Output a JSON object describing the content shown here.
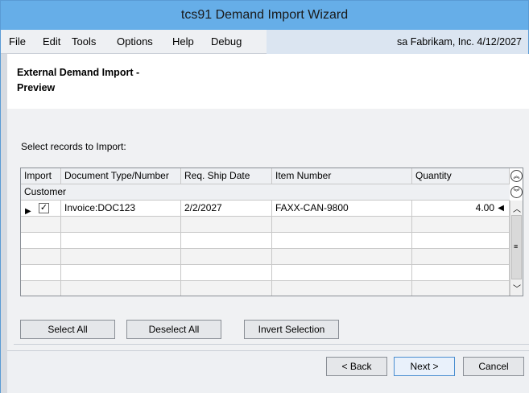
{
  "window": {
    "title": "tcs91 Demand Import Wizard"
  },
  "menubar": {
    "items": [
      "File",
      "Edit",
      "Tools",
      "Options",
      "Help",
      "Debug"
    ],
    "info": "sa  Fabrikam, Inc.  4/12/2027"
  },
  "header": {
    "title": "External Demand Import -\nPreview"
  },
  "main": {
    "select_label": "Select records to Import:"
  },
  "grid": {
    "columns": [
      "Import",
      "Document Type/Number",
      "Req. Ship Date",
      "Item Number",
      "Quantity"
    ],
    "group_label": "Customer",
    "rows": [
      {
        "checked": true,
        "document": "Invoice:DOC123",
        "ship_date": "2/2/2027",
        "item": "FAXX-CAN-9800",
        "quantity": "4.00"
      }
    ]
  },
  "actions": {
    "select_all": "Select All",
    "deselect_all": "Deselect All",
    "invert_selection": "Invert Selection"
  },
  "footer": {
    "back": "< Back",
    "next": "Next >",
    "cancel": "Cancel"
  },
  "colors": {
    "titlebar": "#66aee8",
    "menu_info": "#dbe5f1",
    "panel": "#eef0f3"
  }
}
